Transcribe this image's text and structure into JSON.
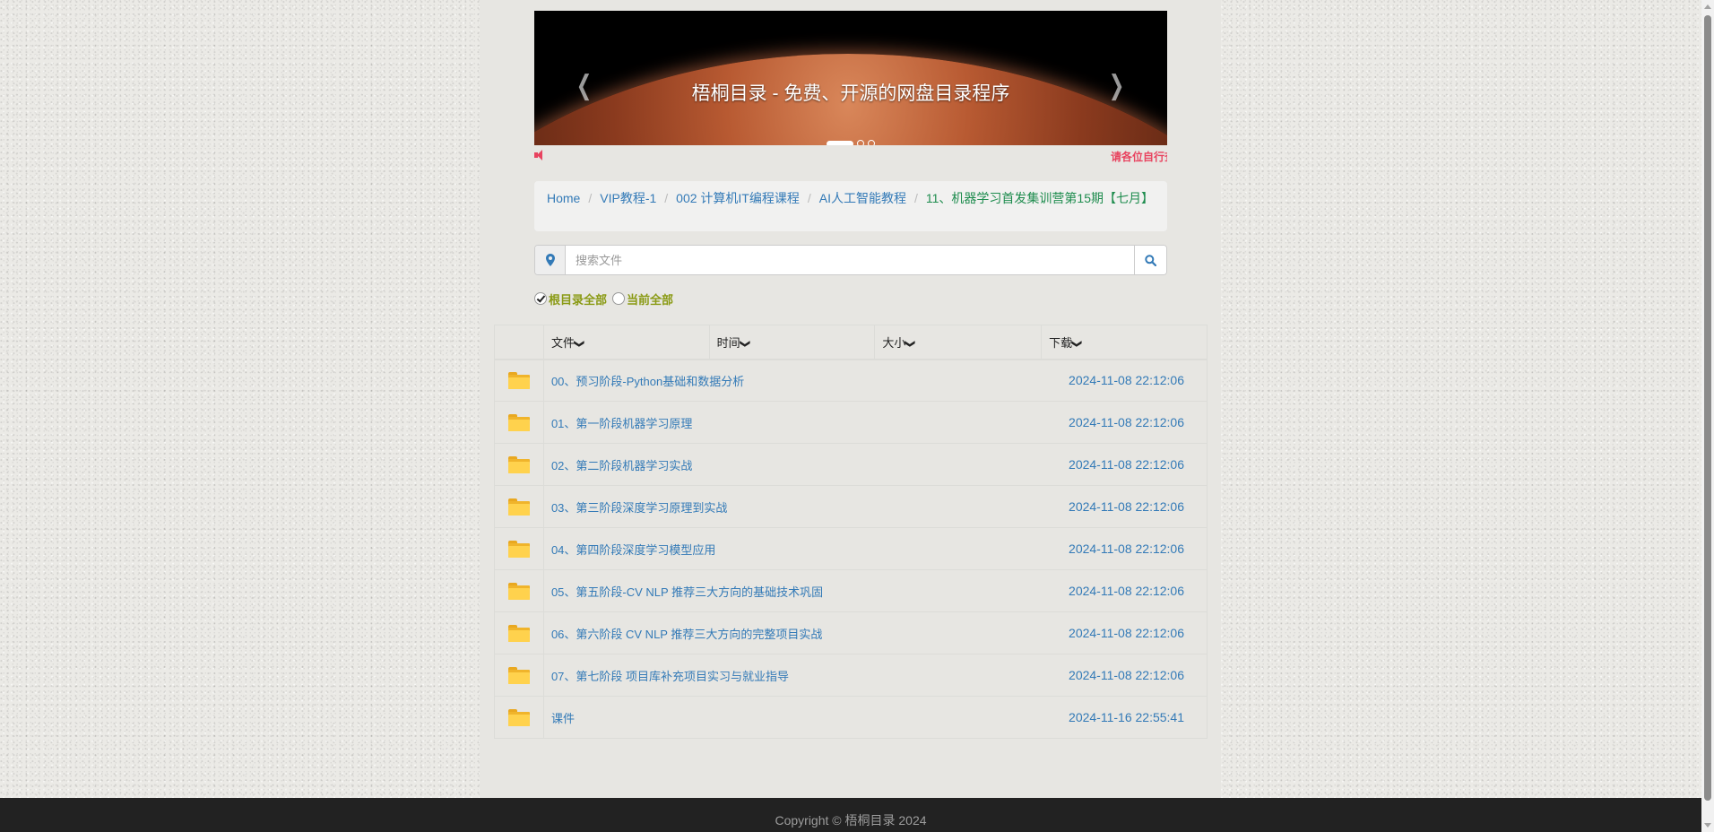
{
  "carousel": {
    "caption": "梧桐目录 - 免费、开源的网盘目录程序",
    "prev_icon": "chevron-left",
    "next_icon": "chevron-right",
    "slide_count": 3,
    "active_slide": 1
  },
  "marquee": {
    "icon": "volume-icon",
    "text": "请各位自行查看目录，请"
  },
  "breadcrumb": {
    "items": [
      "Home",
      "VIP教程-1",
      "002 计算机IT编程课程",
      "AI人工智能教程"
    ],
    "current": "11、机器学习首发集训营第15期【七月】"
  },
  "search": {
    "placeholder": "搜索文件",
    "left_icon": "map-marker-icon",
    "right_icon": "search-icon"
  },
  "filters": [
    {
      "label": "根目录全部",
      "checked": true
    },
    {
      "label": "当前全部",
      "checked": false
    }
  ],
  "table": {
    "headers": [
      "文件",
      "时间",
      "大小",
      "下载"
    ],
    "sort_icon": "❯",
    "rows": [
      {
        "name": "00、预习阶段-Python基础和数据分析",
        "time": "2024-11-08 22:12:06"
      },
      {
        "name": "01、第一阶段机器学习原理",
        "time": "2024-11-08 22:12:06"
      },
      {
        "name": "02、第二阶段机器学习实战",
        "time": "2024-11-08 22:12:06"
      },
      {
        "name": "03、第三阶段深度学习原理到实战",
        "time": "2024-11-08 22:12:06"
      },
      {
        "name": "04、第四阶段深度学习模型应用",
        "time": "2024-11-08 22:12:06"
      },
      {
        "name": "05、第五阶段-CV NLP 推荐三大方向的基础技术巩固",
        "time": "2024-11-08 22:12:06"
      },
      {
        "name": "06、第六阶段 CV NLP 推荐三大方向的完整项目实战",
        "time": "2024-11-08 22:12:06"
      },
      {
        "name": "07、第七阶段 项目库补充项目实习与就业指导",
        "time": "2024-11-08 22:12:06"
      },
      {
        "name": "课件",
        "time": "2024-11-16 22:55:41"
      }
    ]
  },
  "footer": {
    "text": "Copyright © 梧桐目录 2024"
  },
  "colors": {
    "link": "#337ab7",
    "marquee": "#e8435f",
    "filter": "#8a9a14",
    "footer_bg": "#222222",
    "folder": "#ffd24d"
  }
}
